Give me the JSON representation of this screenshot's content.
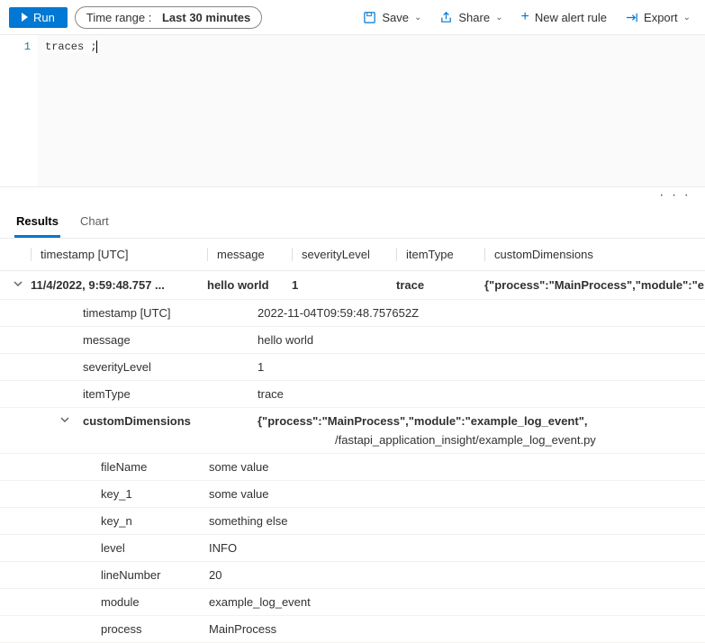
{
  "toolbar": {
    "run": "Run",
    "time_label": "Time range :",
    "time_value": "Last 30 minutes",
    "save": "Save",
    "share": "Share",
    "new_alert": "New alert rule",
    "export": "Export"
  },
  "editor": {
    "line_no": "1",
    "code": "traces ;"
  },
  "tabs": {
    "results": "Results",
    "chart": "Chart"
  },
  "columns": {
    "timestamp": "timestamp [UTC]",
    "message": "message",
    "severity": "severityLevel",
    "itemtype": "itemType",
    "custom": "customDimensions"
  },
  "row": {
    "timestamp": "11/4/2022, 9:59:48.757 ...",
    "message": "hello world",
    "severity": "1",
    "itemtype": "trace",
    "custom": "{\"process\":\"MainProcess\",\"module\":\"e"
  },
  "details": {
    "timestamp_l": "timestamp [UTC]",
    "timestamp_v": "2022-11-04T09:59:48.757652Z",
    "message_l": "message",
    "message_v": "hello world",
    "severity_l": "severityLevel",
    "severity_v": "1",
    "itemtype_l": "itemType",
    "itemtype_v": "trace",
    "custom_l": "customDimensions",
    "custom_v1": "{\"process\":\"MainProcess\",\"module\":\"example_log_event\",",
    "custom_v2": "/fastapi_application_insight/example_log_event.py"
  },
  "sub": {
    "fileName_l": "fileName",
    "fileName_v": "some value",
    "key1_l": "key_1",
    "key1_v": "some value",
    "keyn_l": "key_n",
    "keyn_v": "something else",
    "level_l": "level",
    "level_v": "INFO",
    "lineNumber_l": "lineNumber",
    "lineNumber_v": "20",
    "module_l": "module",
    "module_v": "example_log_event",
    "process_l": "process",
    "process_v": "MainProcess"
  }
}
